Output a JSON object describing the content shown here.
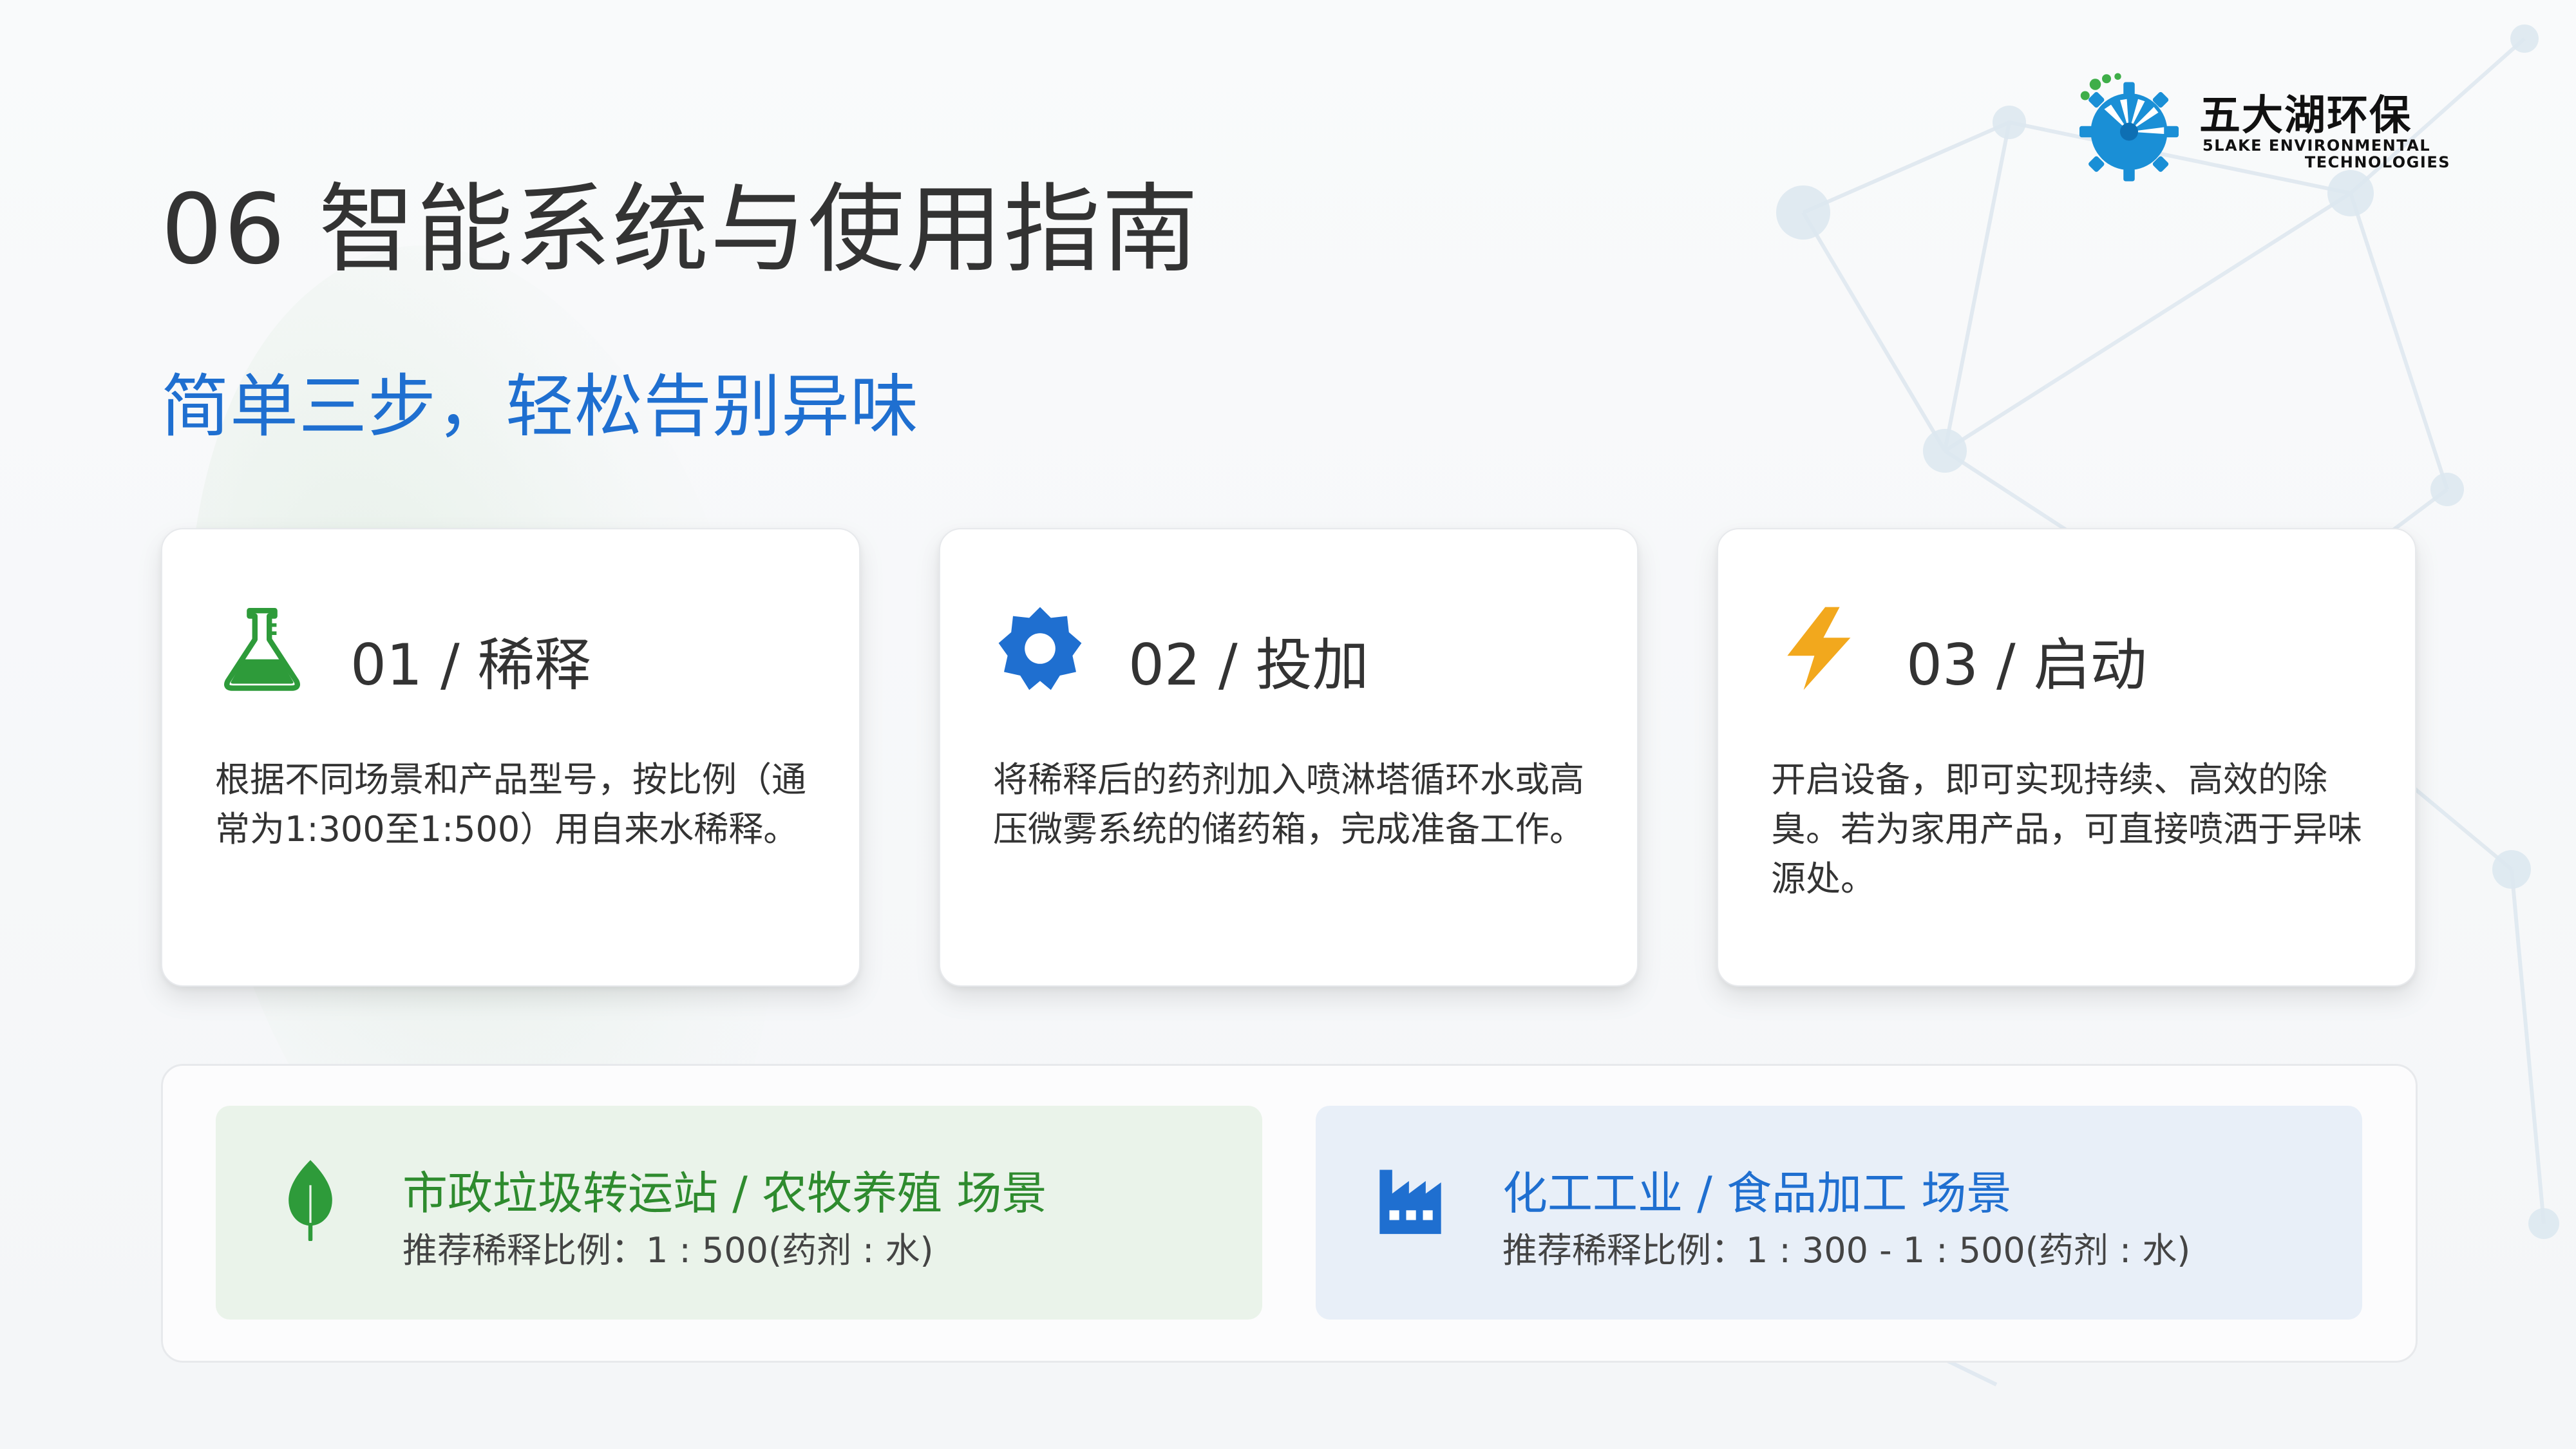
{
  "colors": {
    "accent_blue": "#1f6fd0",
    "accent_green": "#2e8b2e",
    "gold": "#f2a81d"
  },
  "logo": {
    "cn": "五大湖环保",
    "en_line1": "5LAKE ENVIRONMENTAL",
    "en_line2": "TECHNOLOGIES",
    "icon": "gear-globe-logo-icon"
  },
  "title": "06 智能系统与使用指南",
  "subtitle": "简单三步，轻松告别异味",
  "steps": [
    {
      "title": "01 / 稀释",
      "icon": "flask-icon",
      "text": "根据不同场景和产品型号，按比例（通常为1:300至1:500）用自来水稀释。"
    },
    {
      "title": "02 / 投加",
      "icon": "gear-icon",
      "text": "将稀释后的药剂加入喷淋塔循环水或高压微雾系统的储药箱，完成准备工作。"
    },
    {
      "title": "03 / 启动",
      "icon": "lightning-icon",
      "text": "开启设备，即可实现持续、高效的除臭。若为家用产品，可直接喷洒于异味源处。"
    }
  ],
  "scenes": [
    {
      "title": "市政垃圾转运站 / 农牧养殖 场景",
      "desc": "推荐稀释比例：1 : 500(药剂 : 水)",
      "icon": "leaf-icon"
    },
    {
      "title": "化工工业 / 食品加工 场景",
      "desc": "推荐稀释比例：1 : 300 - 1 : 500(药剂 : 水)",
      "icon": "factory-icon"
    }
  ]
}
